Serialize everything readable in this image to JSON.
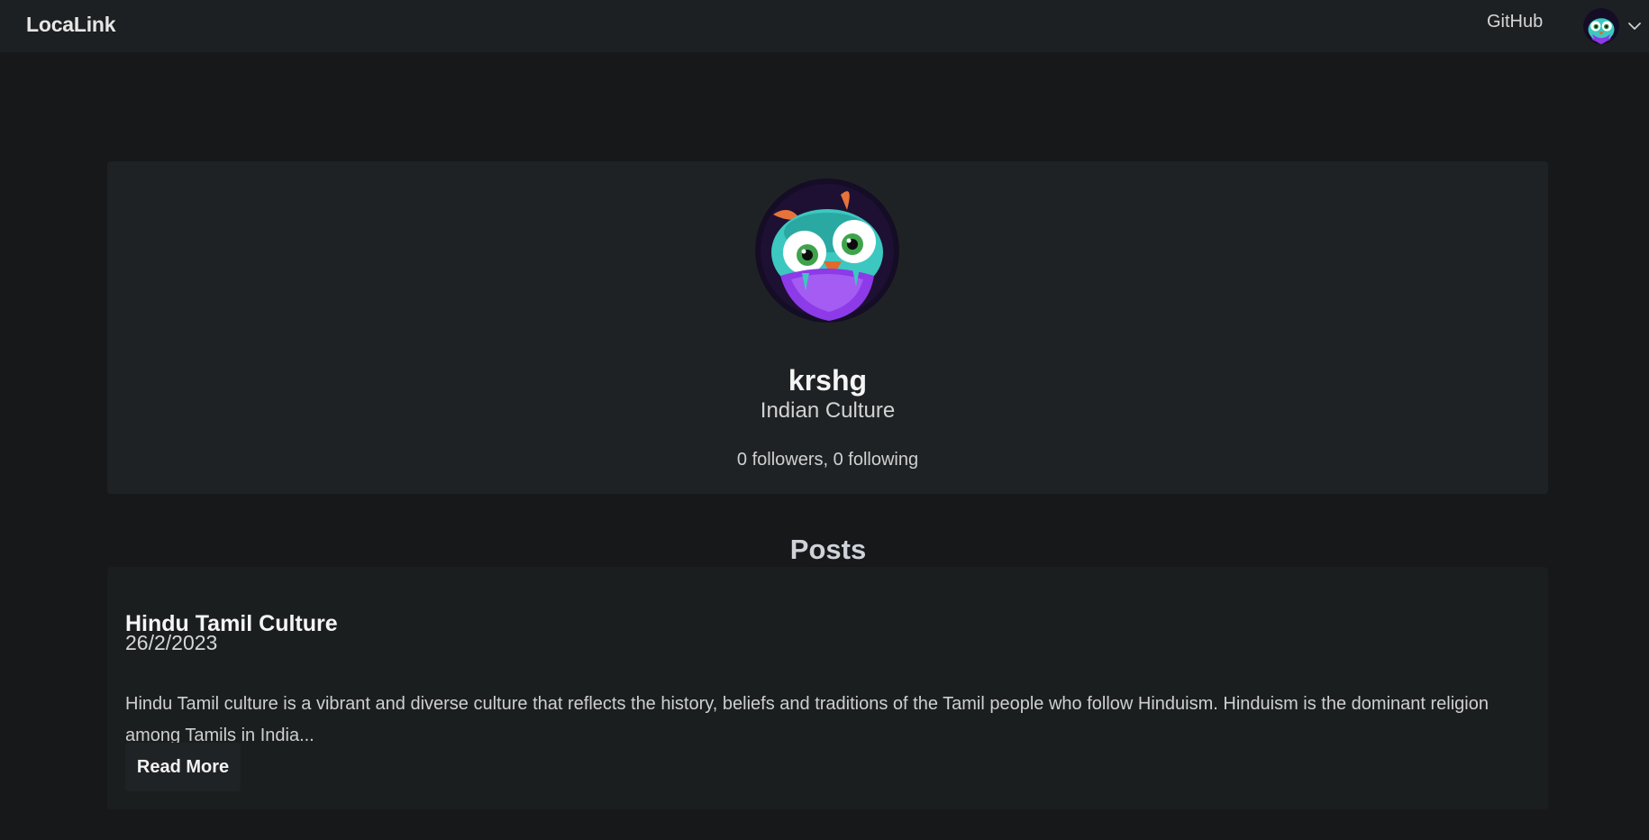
{
  "navbar": {
    "brand": "LocaLink",
    "github_label": "GitHub",
    "avatar_icon": "owl-avatar-icon",
    "dropdown_icon": "chevron-down-icon"
  },
  "profile": {
    "avatar_icon": "owl-avatar-icon",
    "username": "krshg",
    "bio": "Indian Culture",
    "stats": "0 followers, 0 following"
  },
  "posts": {
    "heading": "Posts",
    "items": [
      {
        "title": "Hindu Tamil Culture",
        "date": "26/2/2023",
        "excerpt": "Hindu Tamil culture is a vibrant and diverse culture that reflects the history, beliefs and traditions of the Tamil people who follow Hinduism. Hinduism is the dominant religion among Tamils in India...",
        "read_more_label": "Read More"
      }
    ]
  },
  "colors": {
    "page_background": "#16181a",
    "navbar_background": "#1d2022",
    "card_background": "#1f2224",
    "post_card_background": "#1b1e1f",
    "text_primary": "#f5f5f5"
  }
}
